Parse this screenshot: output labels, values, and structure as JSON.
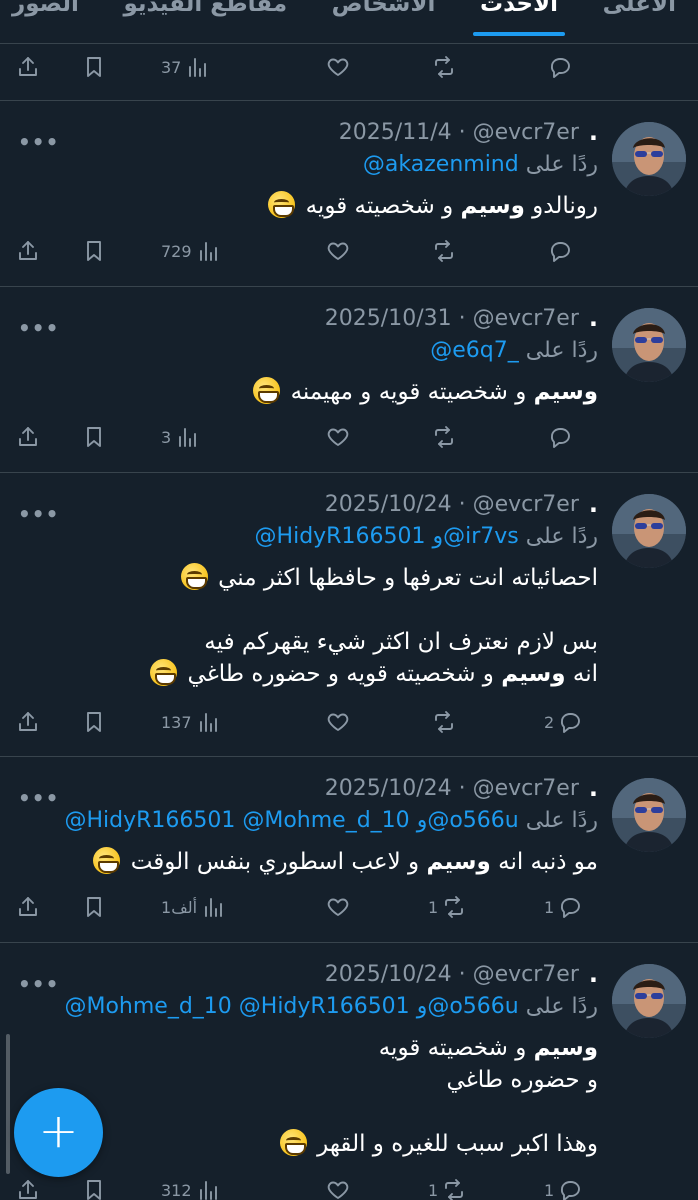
{
  "tabs": [
    {
      "label": "الأعلى",
      "active": false
    },
    {
      "label": "الأحدث",
      "active": true
    },
    {
      "label": "الأشخاص",
      "active": false
    },
    {
      "label": "مقاطع الفيديو",
      "active": false
    },
    {
      "label": "الصور",
      "active": false
    }
  ],
  "top_actions": {
    "views": "37",
    "retweets": "",
    "replies": ""
  },
  "reply_prefix": "ردًا على",
  "tweets": [
    {
      "handle": "@evcr7er",
      "date": "2025/11/4",
      "mentions": "@akazenmind",
      "lines": [
        {
          "pre": "رونالدو ",
          "bold": "وسيم",
          "post": " و شخصيته قويه",
          "emoji": true
        }
      ],
      "stats": {
        "views": "729",
        "retweets": "",
        "replies": ""
      }
    },
    {
      "handle": "@evcr7er",
      "date": "2025/10/31",
      "mentions": "@e6q7_",
      "lines": [
        {
          "pre": "",
          "bold": "وسيم",
          "post": " و شخصيته قويه و مهيمنه",
          "emoji": true
        }
      ],
      "stats": {
        "views": "3",
        "retweets": "",
        "replies": ""
      }
    },
    {
      "handle": "@evcr7er",
      "date": "2025/10/24",
      "mentions": "@HidyR166501 و@ir7vs",
      "lines": [
        {
          "pre": "احصائياته انت تعرفها و حافظها اكثر مني",
          "bold": "",
          "post": "",
          "emoji": true
        },
        {
          "pre": "",
          "bold": "",
          "post": "",
          "emoji": false
        },
        {
          "pre": "بس لازم نعترف ان اكثر شيء يقهركم فيه",
          "bold": "",
          "post": "",
          "emoji": false
        },
        {
          "pre": "انه ",
          "bold": "وسيم",
          "post": " و شخصيته قويه و حضوره طاغي",
          "emoji": true
        }
      ],
      "stats": {
        "views": "137",
        "retweets": "",
        "replies": "2"
      }
    },
    {
      "handle": "@evcr7er",
      "date": "2025/10/24",
      "mentions": "@HidyR166501 @Mohme_d_10 و@o566u",
      "lines": [
        {
          "pre": "مو ذنبه انه ",
          "bold": "وسيم",
          "post": " و لاعب اسطوري بنفس الوقت",
          "emoji": true
        }
      ],
      "stats": {
        "views": "1ألف",
        "retweets": "1",
        "replies": "1"
      }
    },
    {
      "handle": "@evcr7er",
      "date": "2025/10/24",
      "mentions": "@Mohme_d_10 @HidyR166501 و@o566u",
      "lines": [
        {
          "pre": "",
          "bold": "وسيم",
          "post": " و شخصيته قويه",
          "emoji": false
        },
        {
          "pre": "و حضوره طاغي",
          "bold": "",
          "post": "",
          "emoji": false
        },
        {
          "pre": "",
          "bold": "",
          "post": "",
          "emoji": false
        },
        {
          "pre": "وهذا اكبر سبب للغيره و القهر",
          "bold": "",
          "post": "",
          "emoji": true
        }
      ],
      "stats": {
        "views": "312",
        "retweets": "1",
        "replies": "1"
      }
    }
  ],
  "fab": {
    "label": "+"
  },
  "colors": {
    "background": "#15202b",
    "accent": "#1d9bf0",
    "muted": "#8b98a5",
    "divider": "#38444d"
  }
}
